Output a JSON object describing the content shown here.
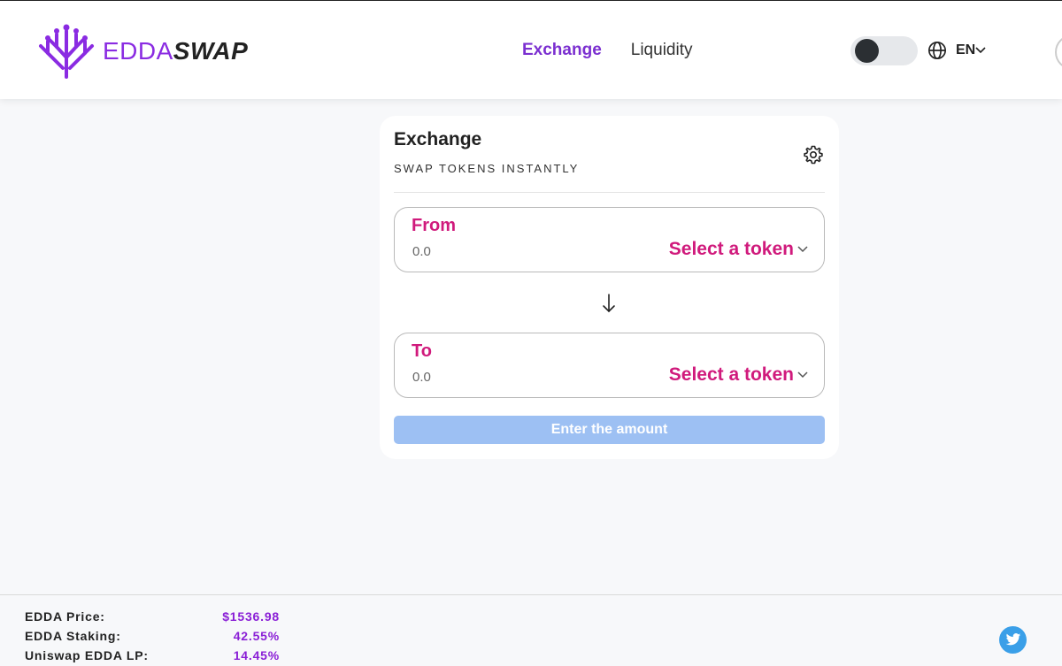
{
  "brand": {
    "name_part1": "EDDA",
    "name_part2": "SWAP",
    "primary_color": "#7b2fd0",
    "accent_color": "#d01a7c"
  },
  "nav": {
    "items": [
      {
        "label": "Exchange",
        "active": true
      },
      {
        "label": "Liquidity",
        "active": false
      }
    ]
  },
  "header": {
    "theme_toggle": "dark-mode-toggle",
    "language": "EN",
    "language_icon": "globe-icon"
  },
  "exchange": {
    "title": "Exchange",
    "subtitle": "SWAP TOKENS INSTANTLY",
    "settings_icon": "gear-icon",
    "from": {
      "label": "From",
      "placeholder": "0.0",
      "value": "",
      "token_label": "Select a token"
    },
    "to": {
      "label": "To",
      "placeholder": "0.0",
      "value": "",
      "token_label": "Select a token"
    },
    "swap_direction_icon": "arrow-down-icon",
    "submit_label": "Enter the amount",
    "submit_color": "#9dc0f3"
  },
  "footer": {
    "stats": [
      {
        "label": "EDDA Price:",
        "value": "$1536.98"
      },
      {
        "label": "EDDA Staking:",
        "value": "42.55%"
      },
      {
        "label": "Uniswap EDDA LP:",
        "value": "14.45%"
      }
    ],
    "social_icon": "twitter-icon"
  }
}
